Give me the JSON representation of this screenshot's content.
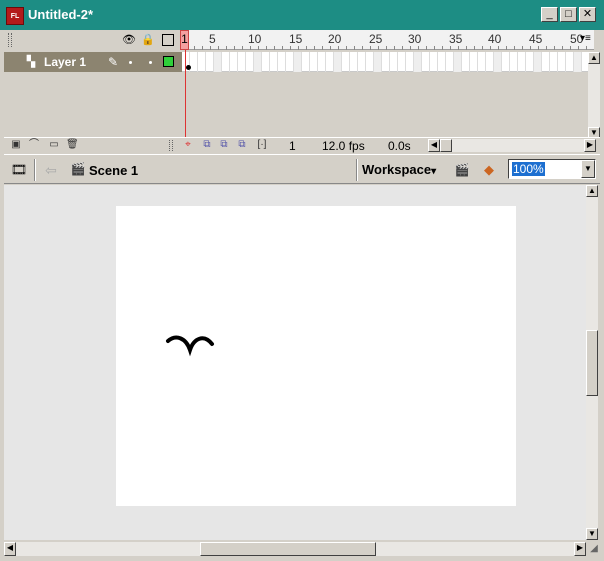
{
  "window": {
    "title": "Untitled-2*",
    "app_icon_text": "FL",
    "controls": [
      "_",
      "□",
      "✕"
    ]
  },
  "timeline": {
    "header_icons": [
      "eye-icon",
      "lock-icon",
      "outline-icon"
    ],
    "ruler_labels": [
      "1",
      "5",
      "10",
      "15",
      "20",
      "25",
      "30",
      "35",
      "40",
      "45",
      "50"
    ],
    "current_frame_marker": "1",
    "layers": [
      {
        "name": "Layer 1",
        "visible_dot": "•",
        "lock_dot": "•",
        "outline_color": "#2fd03a"
      }
    ],
    "footer": {
      "current_frame": "1",
      "frame_rate": "12.0 fps",
      "elapsed_time": "0.0s"
    }
  },
  "editbar": {
    "scene_label": "Scene 1",
    "workspace_label": "Workspace",
    "workspace_arrow": "▾",
    "zoom_value": "100%"
  },
  "colors": {
    "titlebar": "#1d8d84",
    "layer_row": "#8c8470",
    "playhead": "#d33333",
    "stage_bg": "#ffffff"
  }
}
